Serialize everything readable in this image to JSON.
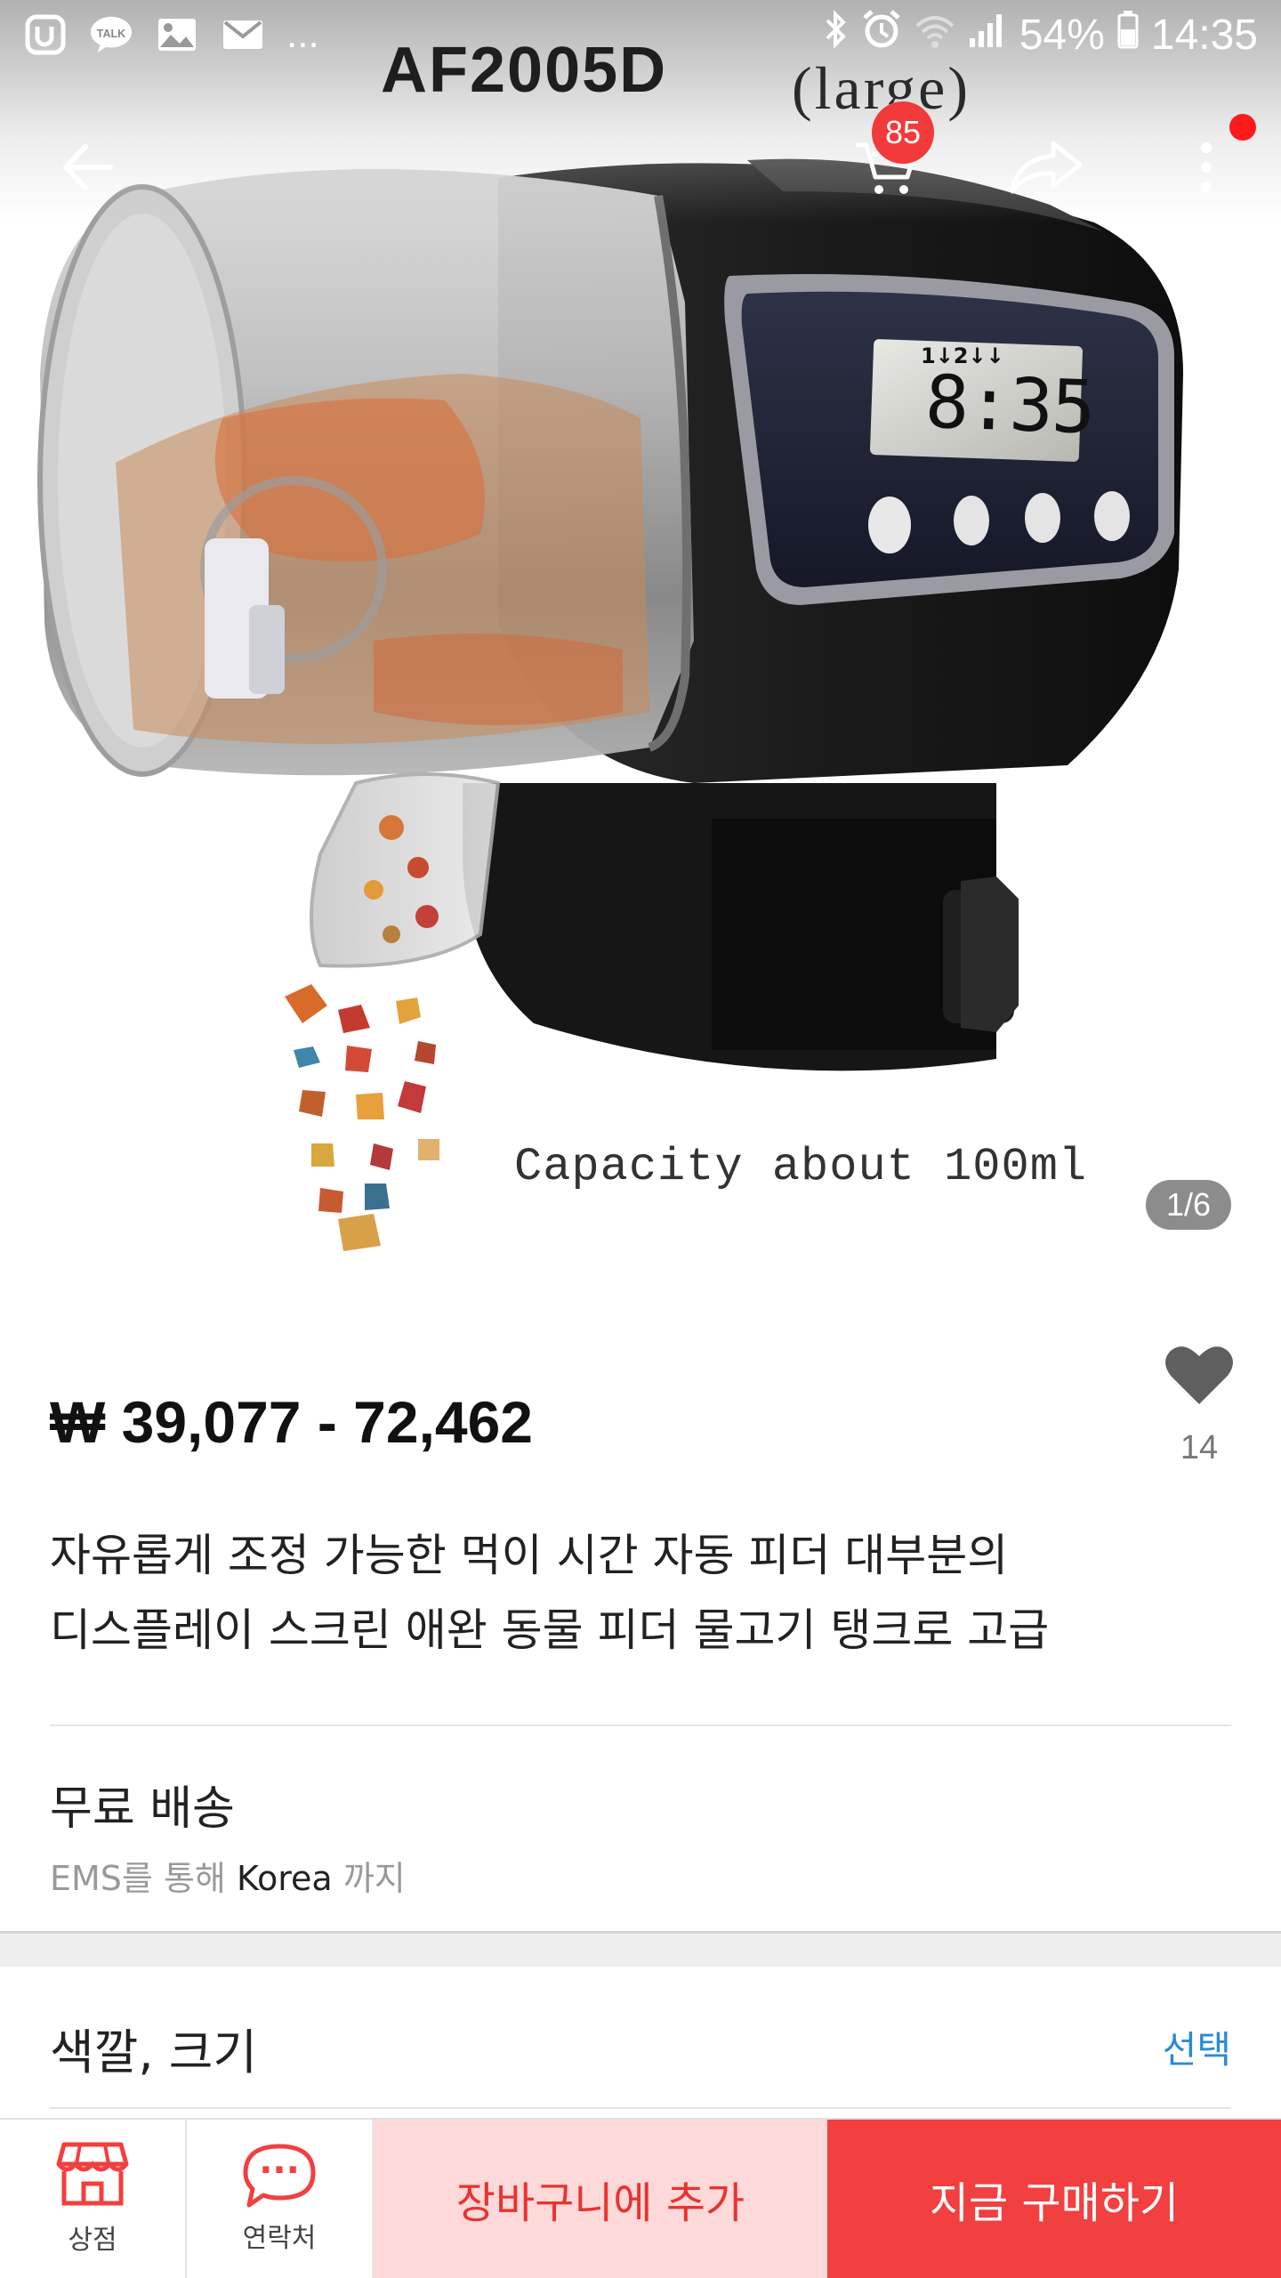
{
  "status_bar": {
    "battery": "54%",
    "time": "14:35",
    "more_indicator": "...",
    "left_icons": [
      "u-plus-icon",
      "kakaotalk-icon",
      "gallery-icon",
      "mail-icon"
    ],
    "right_icons": [
      "bluetooth-icon",
      "alarm-icon",
      "wifi-icon",
      "signal-icon",
      "battery-icon"
    ]
  },
  "header": {
    "cart_badge": "85"
  },
  "hero_image": {
    "model_label": "AF2005D",
    "size_label": "(large)",
    "lcd_time": "8:35",
    "lcd_top": "1↓2↓↓",
    "capacity_text": "Capacity about 100ml",
    "page_indicator": "1/6"
  },
  "product": {
    "price": "₩ 39,077 - 72,462",
    "wish_count": "14",
    "title_line1": "자유롭게 조정 가능한 먹이 시간 자동 피더 대부분의",
    "title_line2": "디스플레이 스크린 애완 동물 피더 물고기 탱크로 고급"
  },
  "shipping": {
    "title": "무료 배송",
    "sub_prefix": "EMS를 통해",
    "destination": "Korea",
    "sub_suffix": "까지"
  },
  "options": {
    "title": "색깔, 크기",
    "select_label": "선택"
  },
  "bottom_bar": {
    "store_label": "상점",
    "contact_label": "연락처",
    "contact_icon_text": "···",
    "add_to_cart": "장바구니에 추가",
    "buy_now": "지금 구매하기"
  },
  "colors": {
    "accent_red": "#f23f3f",
    "cart_bg": "#fdd9d9",
    "link_blue": "#2a8ad8"
  }
}
